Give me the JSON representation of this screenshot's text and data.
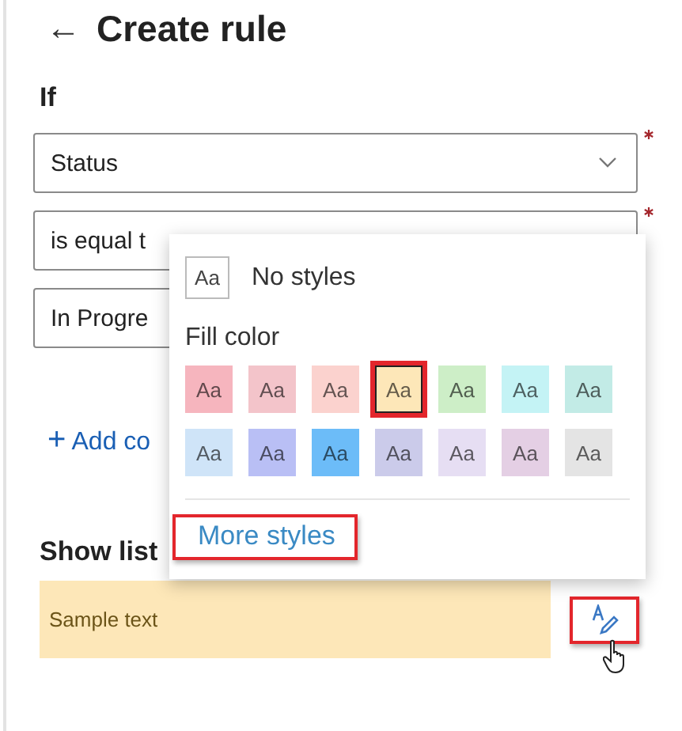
{
  "header": {
    "back": "←",
    "title": "Create rule"
  },
  "condition_heading": "If",
  "fields": [
    {
      "value": "Status",
      "required": true,
      "dropdown": true
    },
    {
      "value": "is equal t",
      "required": true
    },
    {
      "value": "In Progre",
      "required": false
    }
  ],
  "add_condition": {
    "icon": "+",
    "label": "Add co"
  },
  "show_heading": "Show list",
  "preview": {
    "text": "Sample text",
    "color": "#fde7b8"
  },
  "style_button": {
    "highlighted": true
  },
  "style_menu": {
    "no_styles": {
      "swatch": "Aa",
      "label": "No styles"
    },
    "fill_heading": "Fill color",
    "swatches": [
      {
        "label": "Aa",
        "color": "#f6b5be",
        "selected": false
      },
      {
        "label": "Aa",
        "color": "#f3c4ca",
        "selected": false
      },
      {
        "label": "Aa",
        "color": "#fbd2ce",
        "selected": false
      },
      {
        "label": "Aa",
        "color": "#fde7b8",
        "selected": true
      },
      {
        "label": "Aa",
        "color": "#cdeec7",
        "selected": false
      },
      {
        "label": "Aa",
        "color": "#c4f3f5",
        "selected": false
      },
      {
        "label": "Aa",
        "color": "#c2ebe6",
        "selected": false
      },
      {
        "label": "Aa",
        "color": "#cfe4f8",
        "selected": false
      },
      {
        "label": "Aa",
        "color": "#b9bff5",
        "selected": false
      },
      {
        "label": "Aa",
        "color": "#6cbcf8",
        "selected": false
      },
      {
        "label": "Aa",
        "color": "#cbcbea",
        "selected": false
      },
      {
        "label": "Aa",
        "color": "#e6def3",
        "selected": false
      },
      {
        "label": "Aa",
        "color": "#e4cfe4",
        "selected": false
      },
      {
        "label": "Aa",
        "color": "#e4e4e4",
        "selected": false
      }
    ],
    "more_styles": {
      "label": "More styles",
      "highlighted": true
    }
  }
}
